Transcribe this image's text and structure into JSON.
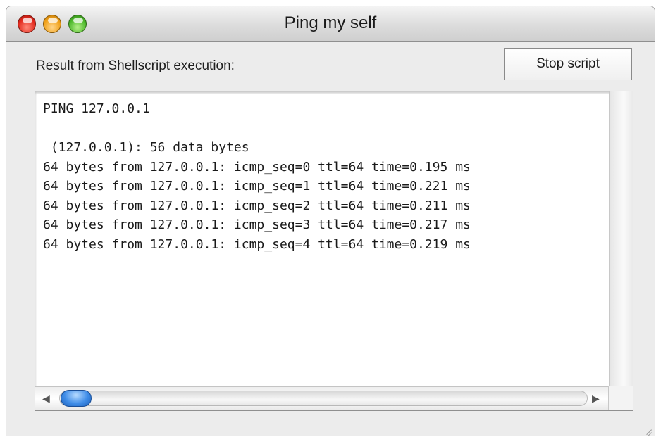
{
  "window": {
    "title": "Ping my self"
  },
  "header": {
    "label": "Result from Shellscript execution:",
    "stop_button_label": "Stop script"
  },
  "output": {
    "text": "PING 127.0.0.1\n\n (127.0.0.1): 56 data bytes\n64 bytes from 127.0.0.1: icmp_seq=0 ttl=64 time=0.195 ms\n64 bytes from 127.0.0.1: icmp_seq=1 ttl=64 time=0.221 ms\n64 bytes from 127.0.0.1: icmp_seq=2 ttl=64 time=0.211 ms\n64 bytes from 127.0.0.1: icmp_seq=3 ttl=64 time=0.217 ms\n64 bytes from 127.0.0.1: icmp_seq=4 ttl=64 time=0.219 ms"
  },
  "icons": {
    "close": "close-button-red",
    "minimize": "minimize-button-yellow",
    "zoom": "zoom-button-green",
    "scroll_left": "arrow-left-icon",
    "scroll_right": "arrow-right-icon",
    "resize": "resize-grip-icon"
  },
  "colors": {
    "close": "#e2281c",
    "minimize": "#f0a11a",
    "zoom": "#4cb82a",
    "scroll_thumb": "#3f8de8"
  }
}
